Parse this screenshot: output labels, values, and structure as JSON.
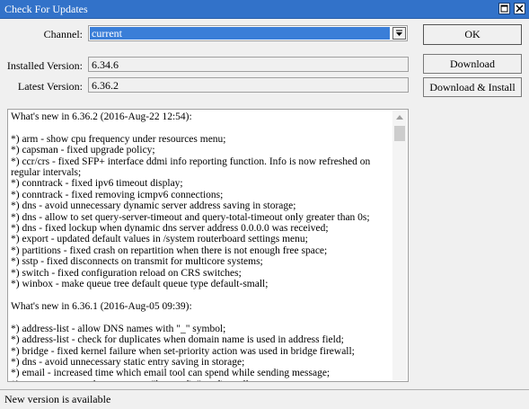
{
  "window": {
    "title": "Check For Updates"
  },
  "form": {
    "channel_label": "Channel:",
    "channel_value": "current",
    "installed_label": "Installed Version:",
    "installed_value": "6.34.6",
    "latest_label": "Latest Version:",
    "latest_value": "6.36.2"
  },
  "buttons": {
    "ok": "OK",
    "download": "Download",
    "download_install": "Download & Install"
  },
  "notes": {
    "text": "What's new in 6.36.2 (2016-Aug-22 12:54):\n\n*) arm - show cpu frequency under resources menu;\n*) capsman - fixed upgrade policy;\n*) ccr/crs - fixed SFP+ interface ddmi info reporting function. Info is now refreshed on regular intervals;\n*) conntrack - fixed ipv6 timeout display;\n*) conntrack - fixed removing icmpv6 connections;\n*) dns - avoid unnecessary dynamic server address saving in storage;\n*) dns - allow to set query-server-timeout and query-total-timeout only greater than 0s;\n*) dns - fixed lockup when dynamic dns server address 0.0.0.0 was received;\n*) export - updated default values in /system routerboard settings menu;\n*) partitions - fixed crash on repartition when there is not enough free space;\n*) sstp - fixed disconnects on transmit for multicore systems;\n*) switch - fixed configuration reload on CRS switches;\n*) winbox - make queue tree default queue type default-small;\n\nWhat's new in 6.36.1 (2016-Aug-05 09:39):\n\n*) address-list - allow DNS names with \"_\" symbol;\n*) address-list - check for duplicates when domain name is used in address field;\n*) bridge - fixed kernel failure when set-priority action was used in bridge firewall;\n*) dns - avoid unnecessary static entry saving in storage;\n*) email - increased time which email tool can spend while sending message;\n*) export -  removed unnecessary \"log-prefix\" on firewall export;"
  },
  "status": {
    "text": "New version is available"
  },
  "icons": {
    "maximize": "maximize-icon",
    "close": "close-icon",
    "dropdown": "dropdown-arrow-icon",
    "scroll_up": "scroll-up-arrow-icon"
  },
  "colors": {
    "titlebar": "#3272c9",
    "selection": "#3a7ed8",
    "background": "#f0f0f0"
  }
}
